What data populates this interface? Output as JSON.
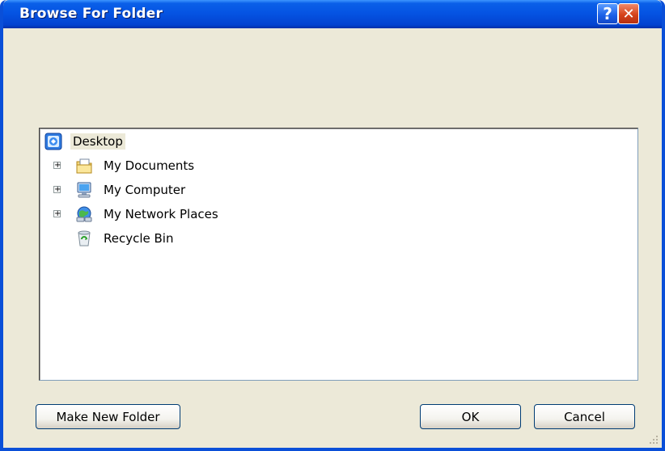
{
  "window": {
    "title": "Browse For Folder"
  },
  "titlebar_buttons": {
    "help": "?",
    "close": "✕"
  },
  "tree": {
    "root": {
      "label": "Desktop",
      "icon": "desktop-icon"
    },
    "items": [
      {
        "label": "My Documents",
        "icon": "my-documents-icon",
        "expander": "+"
      },
      {
        "label": "My Computer",
        "icon": "my-computer-icon",
        "expander": "+"
      },
      {
        "label": "My Network Places",
        "icon": "network-places-icon",
        "expander": "+"
      },
      {
        "label": "Recycle Bin",
        "icon": "recycle-bin-icon",
        "expander": ""
      }
    ]
  },
  "buttons": {
    "make_new_folder": "Make New Folder",
    "ok": "OK",
    "cancel": "Cancel"
  },
  "colors": {
    "title_bar": "#0554e3",
    "dialog_bg": "#ece9d8",
    "selection": "#ece9d8"
  }
}
